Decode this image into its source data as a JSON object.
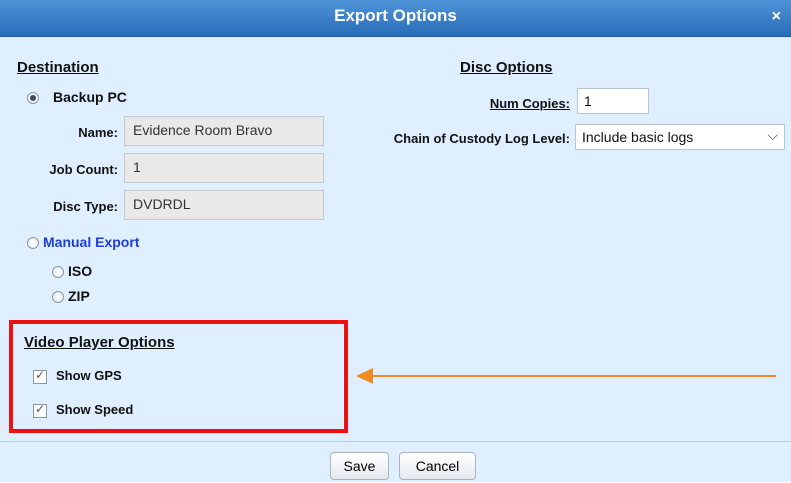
{
  "dialog": {
    "title": "Export Options",
    "close_symbol": "×"
  },
  "destination": {
    "heading": "Destination",
    "backup_pc_label": "Backup PC",
    "name_label": "Name:",
    "name_value": "Evidence Room Bravo",
    "job_count_label": "Job Count:",
    "job_count_value": "1",
    "disc_type_label": "Disc Type:",
    "disc_type_value": "DVDRDL",
    "manual_export_label": "Manual Export",
    "iso_label": "ISO",
    "zip_label": "ZIP",
    "selected": "Backup PC"
  },
  "disc_options": {
    "heading": "Disc Options",
    "num_copies_label": "Num Copies:",
    "num_copies_value": "1",
    "chain_label": "Chain of Custody Log Level:",
    "chain_value": "Include basic logs"
  },
  "video_player": {
    "heading": "Video Player Options",
    "show_gps_label": "Show GPS",
    "show_gps_checked": true,
    "show_speed_label": "Show Speed",
    "show_speed_checked": true
  },
  "footer": {
    "save_label": "Save",
    "cancel_label": "Cancel"
  },
  "colors": {
    "titlebar": "#2a6db8",
    "highlight": "#ee1111",
    "arrow": "#f28a25",
    "link": "#1a3ddb"
  }
}
